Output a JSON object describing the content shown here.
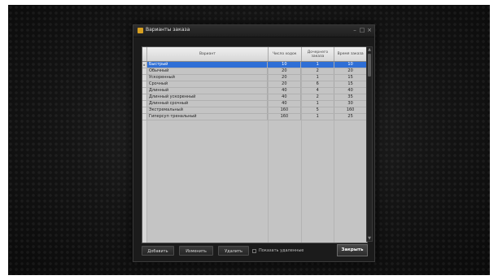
{
  "window": {
    "title": "Варианты заказа",
    "minimize_glyph": "–",
    "maximize_glyph": "□",
    "close_glyph": "×"
  },
  "grid": {
    "columns": [
      "Вариант",
      "Число ходок",
      "Дочернего заказа",
      "Время заказа"
    ],
    "selected_index": 0,
    "rows": [
      {
        "name": "Быстрый",
        "a": "10",
        "b": "1",
        "c": "10"
      },
      {
        "name": "Обычный",
        "a": "20",
        "b": "2",
        "c": "20"
      },
      {
        "name": "Ускоренный",
        "a": "20",
        "b": "1",
        "c": "15"
      },
      {
        "name": "Срочный",
        "a": "20",
        "b": "6",
        "c": "15"
      },
      {
        "name": "Длинный",
        "a": "40",
        "b": "4",
        "c": "40"
      },
      {
        "name": "Длинный ускоренный",
        "a": "40",
        "b": "2",
        "c": "35"
      },
      {
        "name": "Длинный срочный",
        "a": "40",
        "b": "1",
        "c": "30"
      },
      {
        "name": "Экстремальный",
        "a": "160",
        "b": "5",
        "c": "160"
      },
      {
        "name": "Гиперсуп тренальный",
        "a": "160",
        "b": "1",
        "c": "25"
      }
    ],
    "row_marker": "▸"
  },
  "footer": {
    "add_label": "Добавить",
    "edit_label": "Изменить",
    "delete_label": "Удалить",
    "checkbox_label": "Показать удаленные",
    "close_label": "Закрыть"
  },
  "colors": {
    "selection": "#2f6fd6",
    "grid_bg": "#c4c4c4",
    "dialog_bg": "#1b1b1b",
    "title_icon": "#d8a020"
  }
}
